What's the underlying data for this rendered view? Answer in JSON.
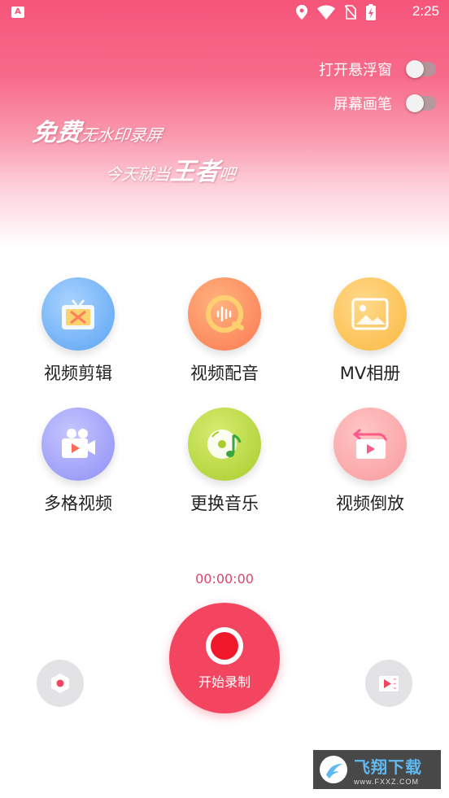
{
  "status_bar": {
    "app_badge": "A",
    "time": "2:25"
  },
  "toggles": [
    {
      "label": "打开悬浮窗",
      "on": false
    },
    {
      "label": "屏幕画笔",
      "on": false
    }
  ],
  "slogan": {
    "line1_big": "免费",
    "line1_small": "无水印录屏",
    "line2_small": "今天就当",
    "line2_big": "王者",
    "line2_tail": "吧"
  },
  "features": [
    {
      "label": "视频剪辑",
      "icon": "tv-scissors-icon"
    },
    {
      "label": "视频配音",
      "icon": "audio-wave-icon"
    },
    {
      "label": "MV相册",
      "icon": "picture-icon"
    },
    {
      "label": "多格视频",
      "icon": "video-camera-icon"
    },
    {
      "label": "更换音乐",
      "icon": "music-disc-icon"
    },
    {
      "label": "视频倒放",
      "icon": "reverse-play-icon"
    }
  ],
  "recorder": {
    "timer": "00:00:00",
    "start_label": "开始录制"
  },
  "watermark": {
    "title": "飞翔下载",
    "url": "www.FXXZ.COM"
  },
  "colors": {
    "brand": "#f44560",
    "record_red": "#f0192c"
  }
}
